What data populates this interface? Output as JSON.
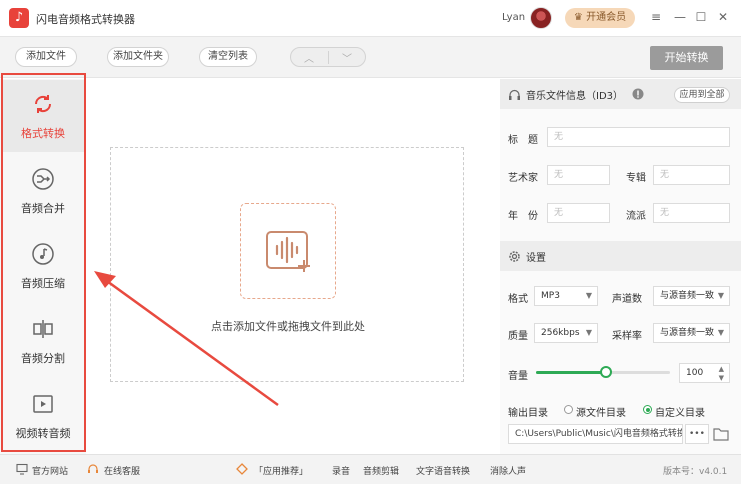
{
  "app": {
    "title": "闪电音频格式转换器",
    "user": "Lyan",
    "vip_label": "开通会员"
  },
  "window_controls": {
    "menu": "≡",
    "minimize": "—",
    "maximize": "☐",
    "close": "✕"
  },
  "toolbar": {
    "add_file": "添加文件",
    "add_folder": "添加文件夹",
    "clear_list": "清空列表",
    "move_up": "︿",
    "move_down": "﹀",
    "start_convert": "开始转换"
  },
  "sidebar": {
    "items": [
      {
        "label": "格式转换",
        "icon": "refresh-icon",
        "active": true
      },
      {
        "label": "音频合并",
        "icon": "merge-icon",
        "active": false
      },
      {
        "label": "音频压缩",
        "icon": "music-note-icon",
        "active": false
      },
      {
        "label": "音频分割",
        "icon": "split-icon",
        "active": false
      },
      {
        "label": "视频转音频",
        "icon": "video-play-icon",
        "active": false
      }
    ]
  },
  "dropzone": {
    "text": "点击添加文件或拖拽文件到此处"
  },
  "id3": {
    "title": "音乐文件信息（ID3）",
    "apply_all": "应用到全部",
    "fields": {
      "song_title": {
        "label": "标　题",
        "placeholder": "无"
      },
      "artist": {
        "label": "艺术家",
        "placeholder": "无"
      },
      "album": {
        "label": "专辑",
        "placeholder": "无"
      },
      "year": {
        "label": "年　份",
        "placeholder": "无"
      },
      "genre": {
        "label": "流派",
        "placeholder": "无"
      }
    }
  },
  "settings": {
    "title": "设置",
    "format": {
      "label": "格式",
      "value": "MP3"
    },
    "channels": {
      "label": "声道数",
      "value": "与源音频一致"
    },
    "quality": {
      "label": "质量",
      "value": "256kbps"
    },
    "sample_rate": {
      "label": "采样率",
      "value": "与源音频一致"
    },
    "volume": {
      "label": "音量",
      "value": "100",
      "level": 0.52
    },
    "output": {
      "label": "输出目录",
      "option_source": "源文件目录",
      "option_custom": "自定义目录",
      "selected": "custom",
      "path": "C:\\Users\\Public\\Music\\闪电音频格式转换",
      "browse": "•••"
    }
  },
  "statusbar": {
    "website": "官方网站",
    "support": "在线客服",
    "recommend": "「应用推荐」",
    "links": [
      "录音",
      "音频剪辑",
      "文字语音转换",
      "消除人声"
    ],
    "version": "版本号：v4.0.1"
  },
  "colors": {
    "accent": "#e8423a",
    "highlight": "#e84a3f",
    "green": "#2eaa55",
    "vip_bg": "#f6d8b8"
  }
}
